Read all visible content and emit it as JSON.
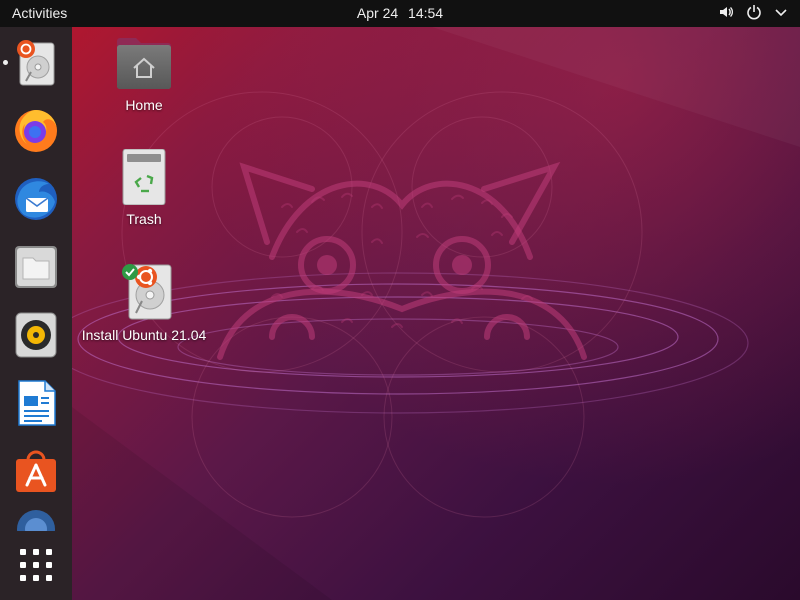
{
  "topbar": {
    "activities_label": "Activities",
    "date": "Apr 24",
    "time": "14:54",
    "tray_icons": [
      "speaker-icon",
      "power-icon",
      "chevron-down-icon"
    ]
  },
  "dock": {
    "items": [
      {
        "name": "Install Ubuntu",
        "icon": "ubuntu-installer-icon",
        "running": true
      },
      {
        "name": "Firefox",
        "icon": "firefox-icon"
      },
      {
        "name": "Thunderbird",
        "icon": "thunderbird-icon"
      },
      {
        "name": "Files",
        "icon": "files-icon"
      },
      {
        "name": "Rhythmbox",
        "icon": "rhythmbox-icon"
      },
      {
        "name": "LibreOffice Writer",
        "icon": "writer-icon"
      },
      {
        "name": "Ubuntu Software",
        "icon": "software-icon"
      },
      {
        "name": "Help",
        "icon": "help-icon"
      }
    ],
    "show_apps_icon": "show-applications-icon"
  },
  "desktop": {
    "icons": [
      {
        "label": "Home",
        "icon": "home-folder-icon"
      },
      {
        "label": "Trash",
        "icon": "trash-icon"
      },
      {
        "label": "Install Ubuntu 21.04",
        "icon": "install-ubuntu-icon"
      }
    ]
  },
  "colors": {
    "accent": "#e95420",
    "topbar": "#111111",
    "dock": "#2b2327"
  }
}
